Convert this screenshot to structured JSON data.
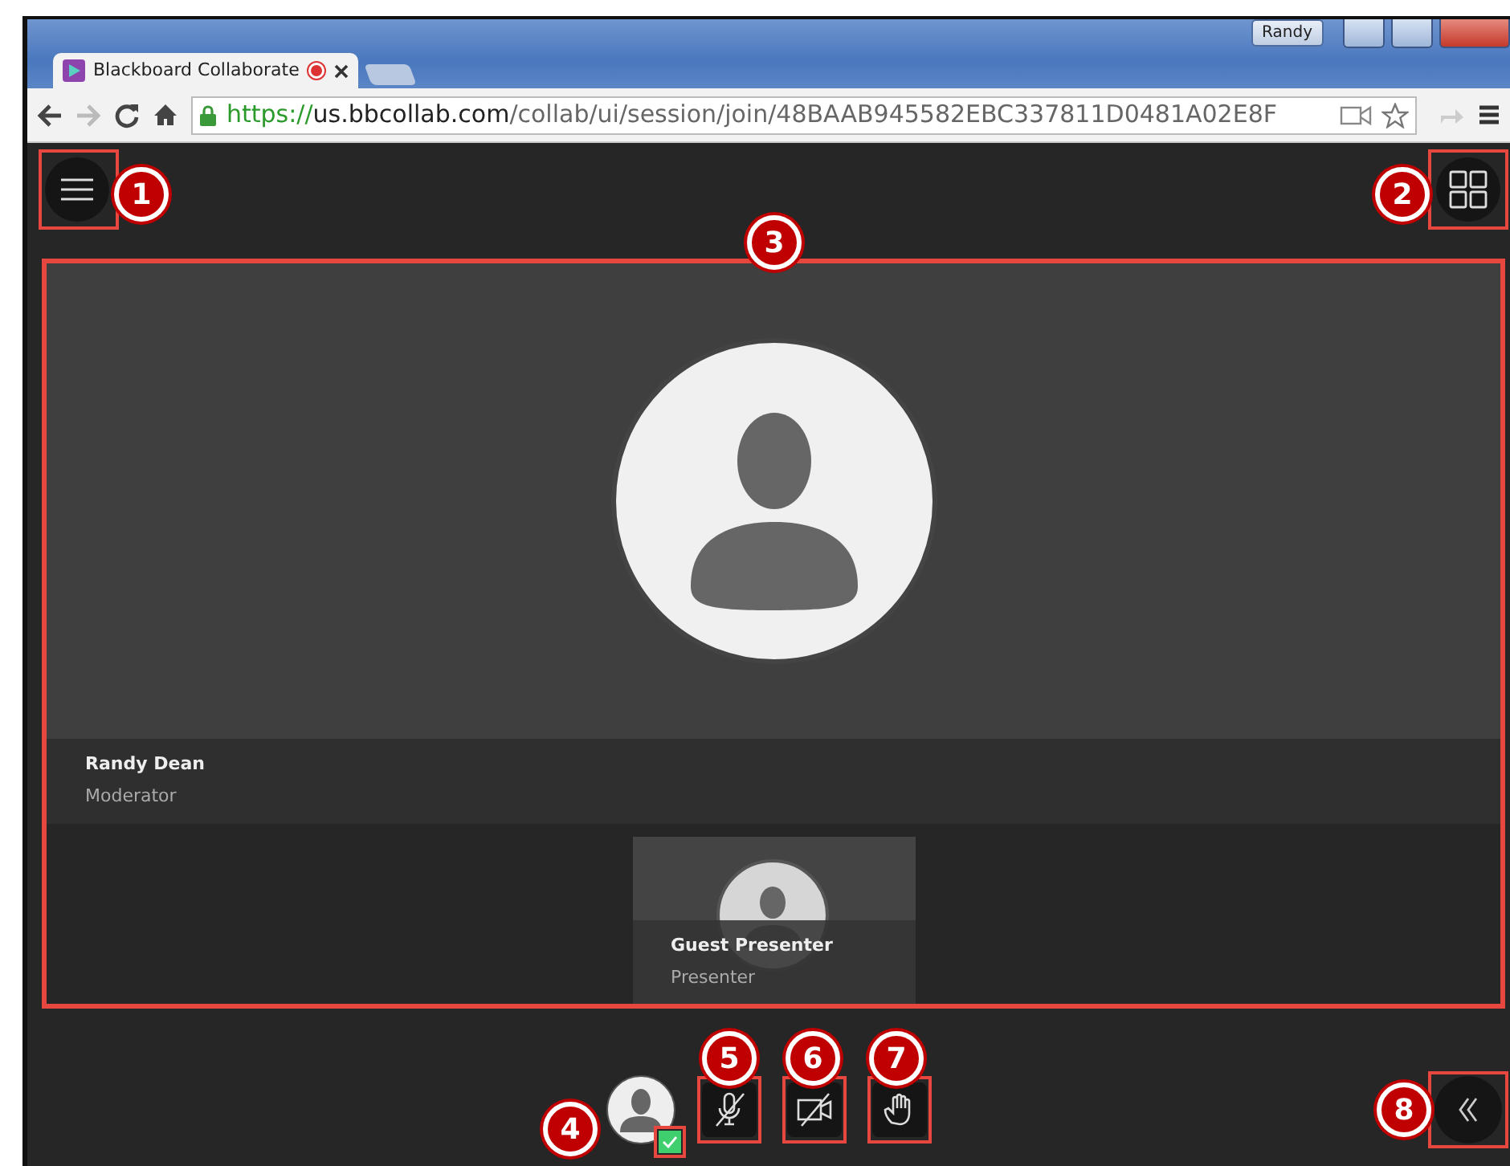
{
  "browser": {
    "tab_title": "Blackboard Collaborate",
    "tab_recording": true,
    "user_button": "Randy",
    "url": {
      "scheme": "https://",
      "host": "us.bbcollab.com",
      "path": "/collab/ui/session/join/48BAAB945582EBC337811D0481A02E8F"
    }
  },
  "main_participant": {
    "name": "Randy Dean",
    "role": "Moderator"
  },
  "thumbnails": [
    {
      "name": "Guest Presenter",
      "role": "Presenter"
    }
  ],
  "status": {
    "checked": true
  },
  "controls": [
    {
      "kind": "mic",
      "off": true
    },
    {
      "kind": "camera",
      "off": true
    },
    {
      "kind": "hand",
      "off": false
    }
  ],
  "callouts": [
    "1",
    "2",
    "3",
    "4",
    "5",
    "6",
    "7",
    "8"
  ]
}
